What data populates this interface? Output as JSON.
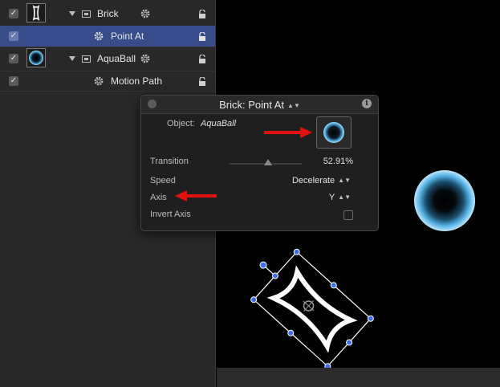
{
  "layers": {
    "rows": [
      {
        "label": "Brick",
        "checked": true,
        "thumb_icon": "brick-shape-icon",
        "type_icon": "group-icon",
        "behavior_icon": "gear-icon",
        "lock_icon": "lock-icon"
      },
      {
        "label": "Point At",
        "checked": true,
        "selected": true,
        "type_icon": "gear-icon",
        "lock_icon": "lock-icon"
      },
      {
        "label": "AquaBall",
        "checked": true,
        "thumb_icon": "aqua-ball-icon",
        "type_icon": "group-icon",
        "behavior_icon": "gear-icon",
        "lock_icon": "lock-icon"
      },
      {
        "label": "Motion Path",
        "checked": true,
        "type_icon": "gear-icon",
        "lock_icon": "lock-icon"
      }
    ]
  },
  "hud": {
    "title": "Brick: Point At",
    "object_label": "Object:",
    "object_value": "AquaBall",
    "transition_label": "Transition",
    "transition_value": "52.91%",
    "transition_level": 0.5291,
    "speed_label": "Speed",
    "speed_value": "Decelerate",
    "axis_label": "Axis",
    "axis_value": "Y",
    "invert_label": "Invert Axis",
    "invert_checked": false
  },
  "colors": {
    "selection": "#384c8c",
    "annotation_arrow": "#e0120f",
    "handle": "#3f6ee8",
    "aqua_rim": "#5fb4e6"
  }
}
